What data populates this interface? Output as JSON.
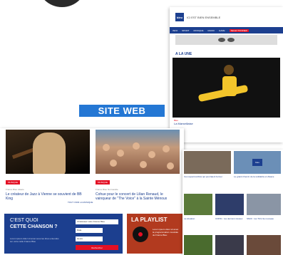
{
  "colors": {
    "brand_blue": "#1c3f8f",
    "accent_red": "#e30f24",
    "label_blue": "#2477d4",
    "dark_circle": "#2a2a2a"
  },
  "label": {
    "text": "SITE WEB"
  },
  "website": {
    "logo_text": "bleu",
    "site_name": "ICI EST BIEN ENSEMBLE",
    "nav": [
      "INFO",
      "SPORT",
      "MUSIQUE",
      "RADIO",
      "GARE",
      "SELECTIONNER"
    ],
    "section": "A LA UNE",
    "hero_caption_kicker": "Bleu",
    "hero_caption_title": "La Marseillaise"
  },
  "left_page": {
    "cards": [
      {
        "tag": "MUSIQUE",
        "meta": "France Bleu Alsace",
        "title": "Le créateur de Jazz à Vienne se souvient de BB King"
      },
      {
        "tag": "MUSIQUE",
        "meta": "France Bleu Normandie",
        "title": "Cohue pour le concert de Lilian Renaud, le vainqueur de \"The Voice\" à la Sainte Ménoux"
      }
    ],
    "more_link": "TOUT VOIR LA MUSIQUE",
    "quiz": {
      "line1": "C'EST QUOI",
      "line2": "CETTE CHANSON ?",
      "desc": "Lorem ipsum dolor sit amet sous les titres entendus sur votre radio France Bleu",
      "selects": [
        "Choisissez votre France Bleu",
        "Date",
        "Heure"
      ],
      "button": "Rechercher"
    },
    "playlist": {
      "title": "LA PLAYLIST",
      "desc": "Lorem ipsum dolor sit amet la programmation musicale de France Bleu"
    }
  },
  "mobile": {
    "captions": [
      "Ces supermarchés qui pourraient fermer",
      "Le grand chemin de la solidarité en Alsace",
      "La situation",
      "COP21 : les derniers travaux",
      "SNCF : les TGV de nouveau"
    ],
    "logo_text": "bleu"
  }
}
